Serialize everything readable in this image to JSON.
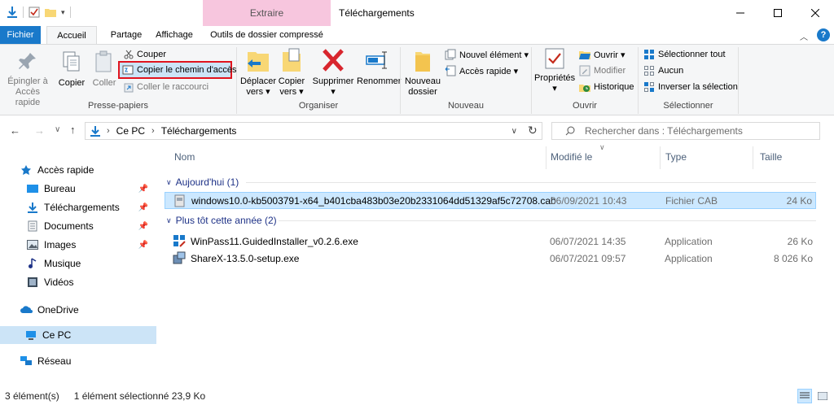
{
  "window": {
    "title": "Téléchargements",
    "context_tab": "Extraire"
  },
  "tabs": {
    "fichier": "Fichier",
    "accueil": "Accueil",
    "partage": "Partage",
    "affichage": "Affichage",
    "outils": "Outils de dossier compressé"
  },
  "ribbon": {
    "presse_papiers": {
      "label": "Presse-papiers",
      "epingler": [
        "Épingler à",
        "Accès rapide"
      ],
      "copier": "Copier",
      "coller": "Coller",
      "couper": "Couper",
      "copier_chemin": "Copier le chemin d'accès",
      "coller_raccourci": "Coller le raccourci"
    },
    "organiser": {
      "label": "Organiser",
      "deplacer": [
        "Déplacer",
        "vers ▾"
      ],
      "copier_vers": [
        "Copier",
        "vers ▾"
      ],
      "supprimer": [
        "Supprimer",
        "▾"
      ],
      "renommer": "Renommer"
    },
    "nouveau": {
      "label": "Nouveau",
      "nouveau_dossier": [
        "Nouveau",
        "dossier"
      ],
      "nouvel_element": "Nouvel élément ▾",
      "acces_rapide": "Accès rapide ▾"
    },
    "ouvrir": {
      "label": "Ouvrir",
      "proprietes": [
        "Propriétés",
        "▾"
      ],
      "ouvrir": "Ouvrir ▾",
      "modifier": "Modifier",
      "historique": "Historique"
    },
    "selectionner": {
      "label": "Sélectionner",
      "tout": "Sélectionner tout",
      "aucun": "Aucun",
      "inverser": "Inverser la sélection"
    }
  },
  "address": {
    "segments": [
      "Ce PC",
      "Téléchargements"
    ],
    "search_placeholder": "Rechercher dans : Téléchargements"
  },
  "nav": {
    "items": [
      {
        "label": "Accès rapide",
        "icon": "star-icon"
      },
      {
        "label": "Bureau",
        "icon": "desktop-icon",
        "pinned": true
      },
      {
        "label": "Téléchargements",
        "icon": "download-icon",
        "pinned": true
      },
      {
        "label": "Documents",
        "icon": "documents-icon",
        "pinned": true
      },
      {
        "label": "Images",
        "icon": "images-icon",
        "pinned": true
      },
      {
        "label": "Musique",
        "icon": "music-icon"
      },
      {
        "label": "Vidéos",
        "icon": "videos-icon"
      },
      {
        "label": "OneDrive",
        "icon": "onedrive-icon"
      },
      {
        "label": "Ce PC",
        "icon": "pc-icon",
        "selected": true
      },
      {
        "label": "Réseau",
        "icon": "network-icon"
      }
    ]
  },
  "columns": {
    "nom": "Nom",
    "modifie": "Modifié le",
    "type": "Type",
    "taille": "Taille"
  },
  "groups": [
    {
      "label": "Aujourd'hui (1)",
      "files": [
        {
          "name": "windows10.0-kb5003791-x64_b401cba483b03e20b2331064dd51329af5c72708.cab",
          "date": "06/09/2021 10:43",
          "type": "Fichier CAB",
          "size": "24 Ko",
          "selected": true
        }
      ]
    },
    {
      "label": "Plus tôt cette année (2)",
      "files": [
        {
          "name": "WinPass11.GuidedInstaller_v0.2.6.exe",
          "date": "06/07/2021 14:35",
          "type": "Application",
          "size": "26 Ko"
        },
        {
          "name": "ShareX-13.5.0-setup.exe",
          "date": "06/07/2021 09:57",
          "type": "Application",
          "size": "8 026 Ko"
        }
      ]
    }
  ],
  "status": {
    "count": "3 élément(s)",
    "selection": "1 élément sélectionné  23,9 Ko"
  },
  "colors": {
    "accent": "#1979ca",
    "context_tab": "#f7c6de",
    "selection": "#cce8ff",
    "highlight_border": "#e0141e"
  }
}
